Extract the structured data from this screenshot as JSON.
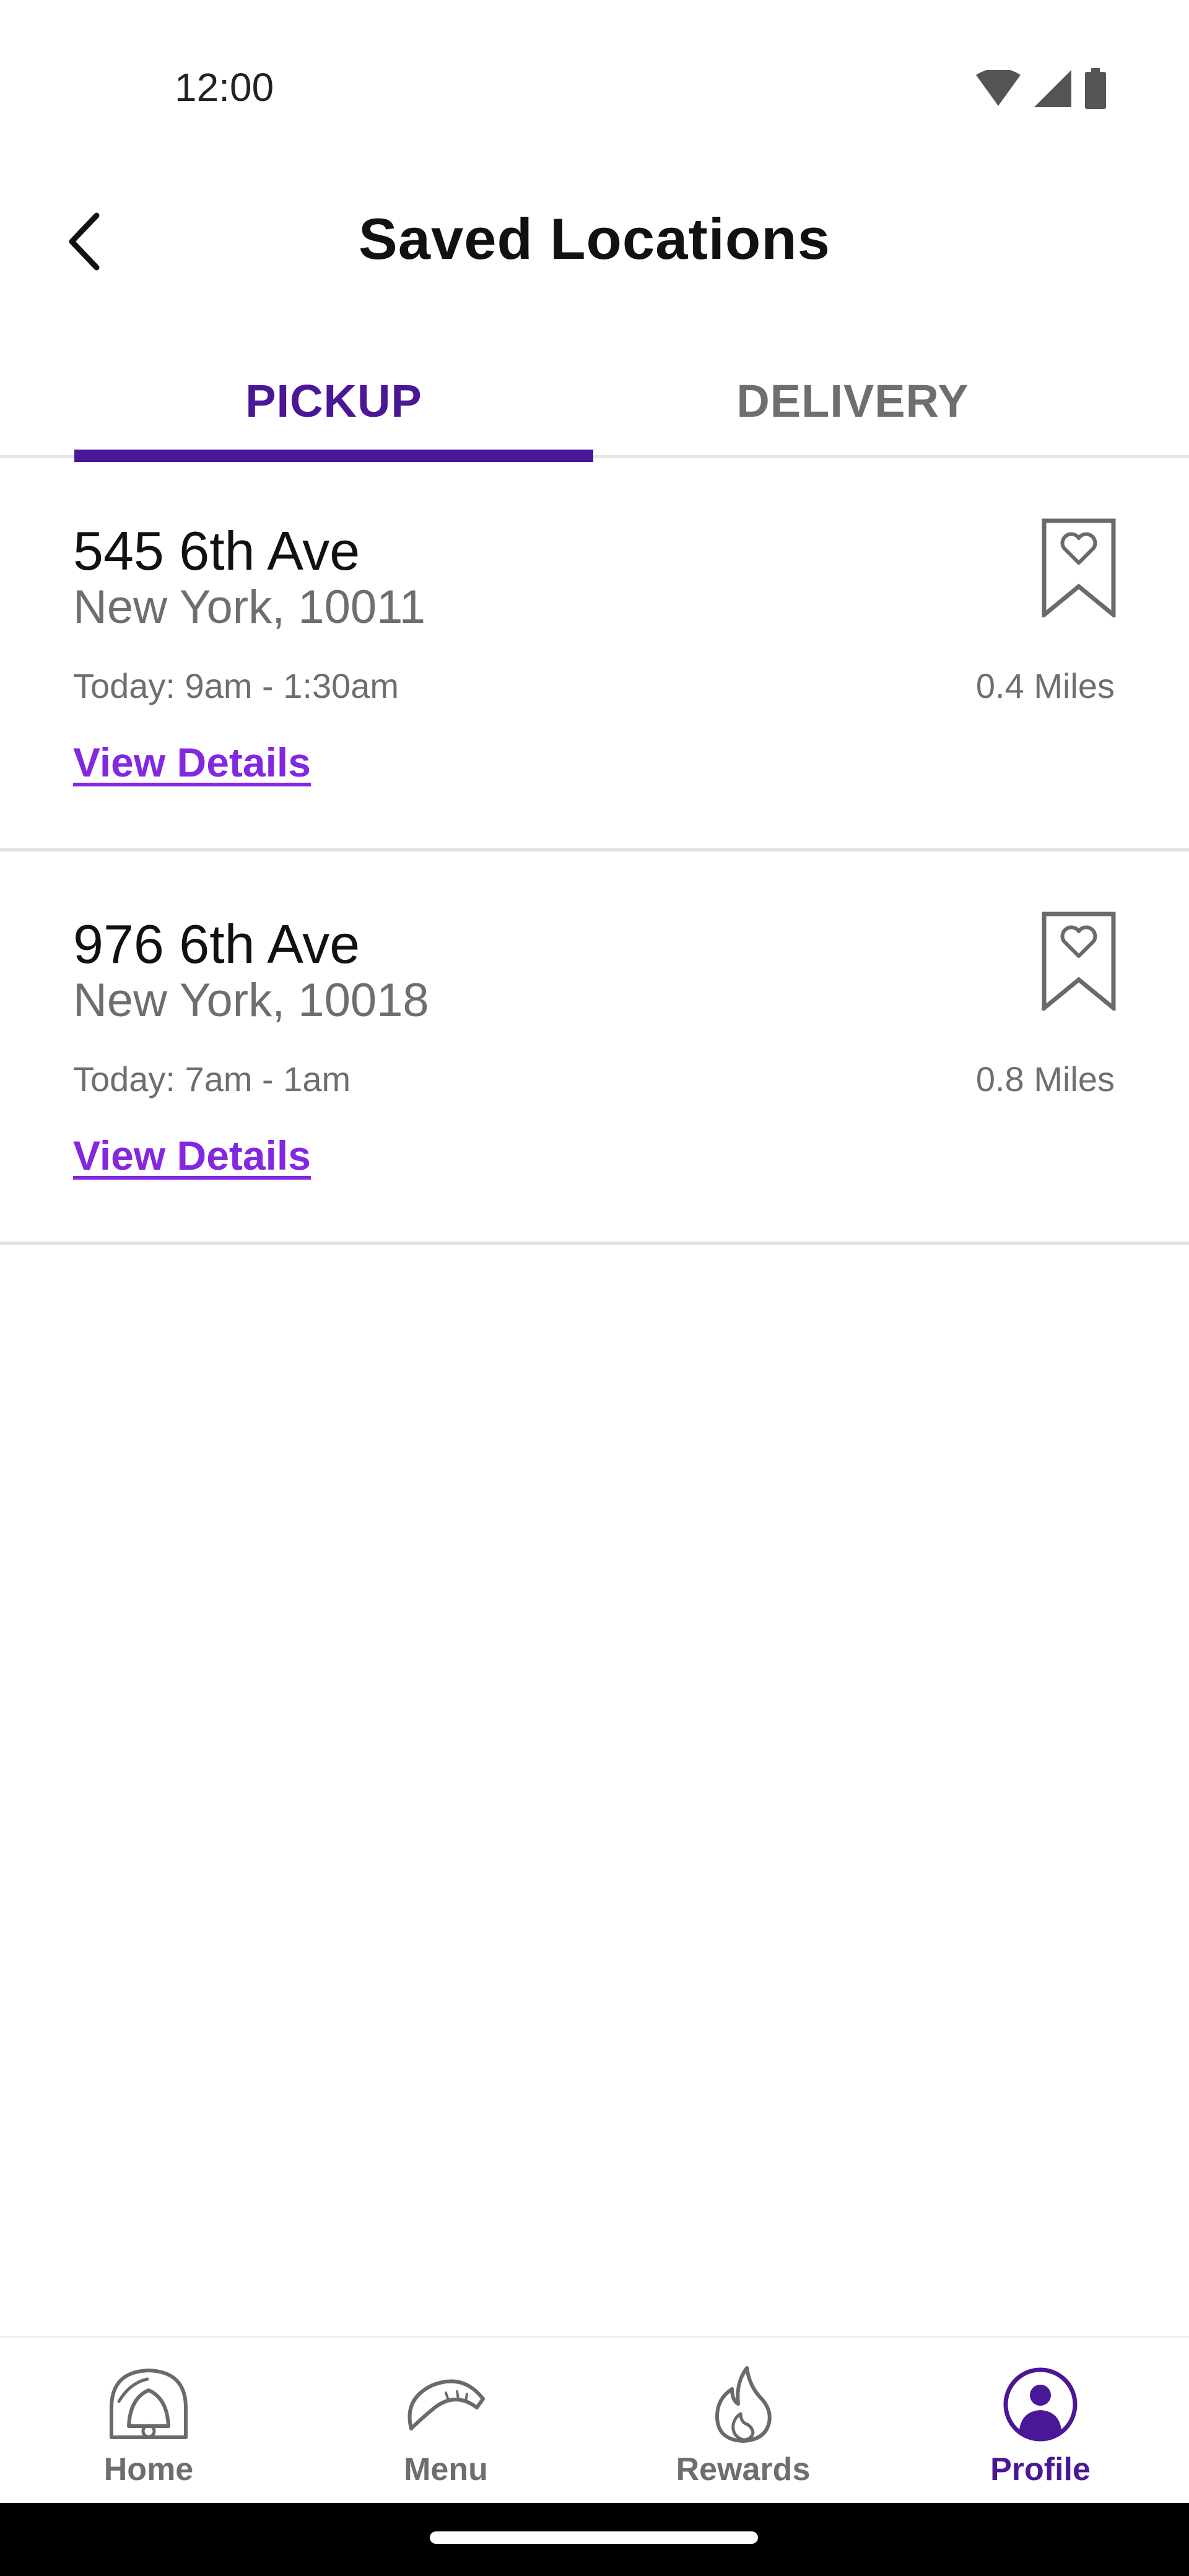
{
  "status_bar": {
    "time": "12:00"
  },
  "header": {
    "title": "Saved Locations"
  },
  "tabs": [
    {
      "label": "PICKUP",
      "active": true
    },
    {
      "label": "DELIVERY",
      "active": false
    }
  ],
  "locations": [
    {
      "street": "545 6th Ave",
      "city": "New York,  10011",
      "hours": "Today: 9am - 1:30am",
      "distance": "0.4 Miles",
      "link": "View Details"
    },
    {
      "street": "976 6th Ave",
      "city": "New York,  10018",
      "hours": "Today: 7am - 1am",
      "distance": "0.8 Miles",
      "link": "View Details"
    }
  ],
  "bottom_nav": [
    {
      "label": "Home",
      "icon": "taco-bell-icon",
      "active": false
    },
    {
      "label": "Menu",
      "icon": "taco-icon",
      "active": false
    },
    {
      "label": "Rewards",
      "icon": "flame-icon",
      "active": false
    },
    {
      "label": "Profile",
      "icon": "profile-icon",
      "active": true
    }
  ],
  "colors": {
    "accent": "#4a1796",
    "link": "#8427e0",
    "muted": "#6e6e6e"
  }
}
